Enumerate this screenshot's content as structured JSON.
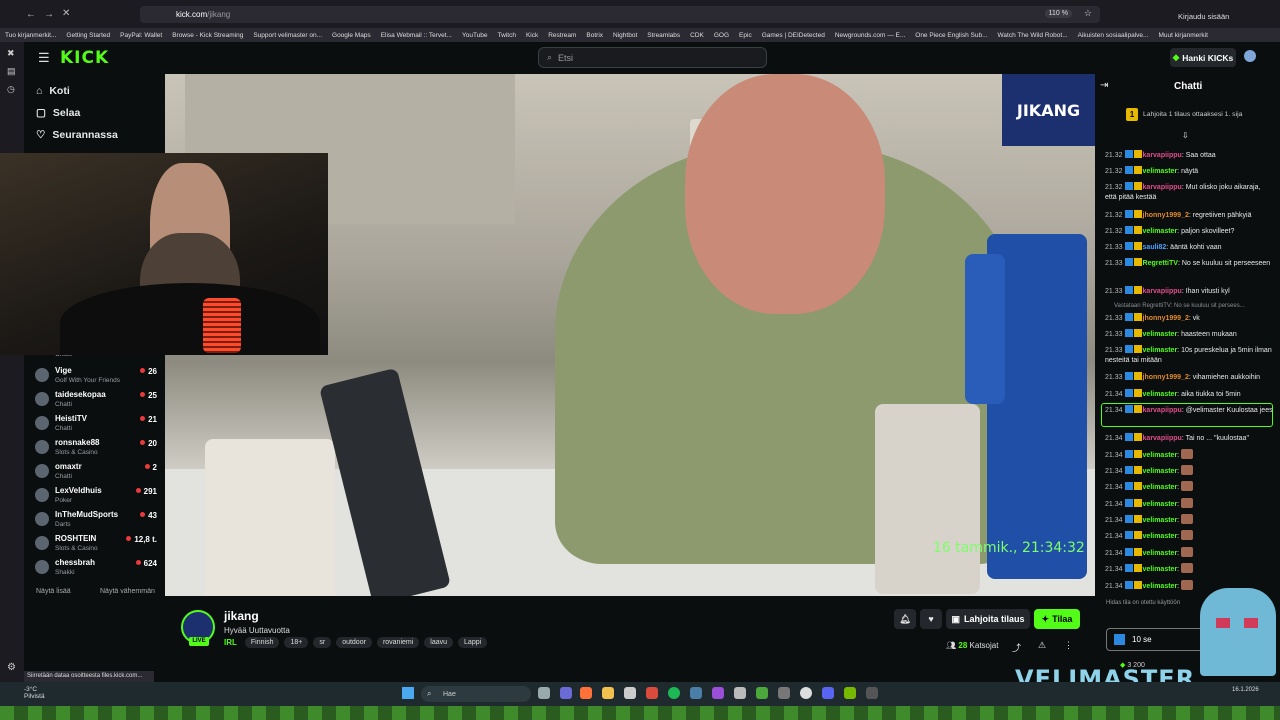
{
  "browser": {
    "url_host": "kick.com",
    "url_path": "/jikang",
    "zoom": "110 %",
    "login": "Kirjaudu sisään",
    "bookmarks": [
      "Tuo kirjanmerkit...",
      "Getting Started",
      "PayPal: Wallet",
      "Browse - Kick Streaming",
      "Support velimaster on...",
      "Google Maps",
      "Elisa Webmail :: Tervet...",
      "YouTube",
      "Twitch",
      "Kick",
      "Restream",
      "Botrix",
      "Nightbot",
      "Streamlabs",
      "CDK",
      "GOG",
      "Epic",
      "Games | DEIDetected",
      "Newgrounds.com — E...",
      "One Piece English Sub...",
      "Watch The Wild Robot...",
      "Aikuisten sosiaalipalve...",
      "Muut kirjanmerkit"
    ]
  },
  "kick": {
    "logo": "KICK",
    "search_placeholder": "Etsi",
    "hanki_label": "Hanki KICKs",
    "nav": {
      "home": "Koti",
      "browse": "Selaa",
      "following": "Seurannassa"
    },
    "channels": [
      {
        "name": "",
        "category": "Chatti",
        "viewers": ""
      },
      {
        "name": "Vige",
        "category": "Golf With Your Friends",
        "viewers": "26"
      },
      {
        "name": "taidesekopaa",
        "category": "Chatti",
        "viewers": "25"
      },
      {
        "name": "HeistiTV",
        "category": "Chatti",
        "viewers": "21"
      },
      {
        "name": "ronsnake88",
        "category": "Slots & Casino",
        "viewers": "20"
      },
      {
        "name": "omaxtr",
        "category": "Chatti",
        "viewers": "2"
      },
      {
        "name": "LexVeldhuis",
        "category": "Poker",
        "viewers": "291"
      },
      {
        "name": "InTheMudSports",
        "category": "Darts",
        "viewers": "43"
      },
      {
        "name": "ROSHTEIN",
        "category": "Slots & Casino",
        "viewers": "12,8 t."
      },
      {
        "name": "chessbrah",
        "category": "Shakki",
        "viewers": "624"
      }
    ],
    "show_more": "Näytä lisää",
    "show_less": "Näytä vähemmän"
  },
  "stream": {
    "channel": "jikang",
    "title": "Hyvää Uuttavuotta",
    "category": "IRL",
    "tags": [
      "Finnish",
      "18+",
      "sr",
      "outdoor",
      "rovaniemi",
      "laavu",
      "Lappi"
    ],
    "live_label": "LIVE",
    "gift_label": "Lahjoita tilaus",
    "sub_label": "Tilaa",
    "viewers": "28",
    "viewers_label": "Katsojat",
    "timestamp_overlay": "16 tammik., 21:34:32",
    "badge": "JIKANG"
  },
  "chat": {
    "title": "Chatti",
    "sub_prompt_rank": "1",
    "sub_prompt": "Lahjoita 1 tilaus ottaaksesi 1. sija",
    "messages": [
      {
        "time": "21.32",
        "user": "karvapiippu",
        "color": "#e04c8a",
        "text": "Saa ottaa"
      },
      {
        "time": "21.32",
        "user": "velimaster",
        "color": "#53fc18",
        "text": "näytä"
      },
      {
        "time": "21.32",
        "user": "karvapiippu",
        "color": "#e04c8a",
        "text": "Mut olisko joku aikaraja, että pitää kestää"
      },
      {
        "time": "21.32",
        "user": "jhonny1999_2",
        "color": "#e08a2c",
        "text": "regretiiven pähkyiä"
      },
      {
        "time": "21.32",
        "user": "velimaster",
        "color": "#53fc18",
        "text": "paljon skovilleet?"
      },
      {
        "time": "21.33",
        "user": "sauli82",
        "color": "#4aa3ff",
        "text": "ääntä kohti vaan"
      },
      {
        "time": "21.33",
        "user": "RegrettiTV",
        "color": "#53fc18",
        "text": "No se kuuluu sit perseeseen"
      },
      {
        "time": "21.33",
        "user": "karvapiippu",
        "color": "#e04c8a",
        "text": "Ihan vitusti kyl"
      },
      {
        "time": "21.33",
        "user": "jhonny1999_2",
        "color": "#e08a2c",
        "text": "vk"
      },
      {
        "time": "21.33",
        "user": "velimaster",
        "color": "#53fc18",
        "text": "haasteen mukaan"
      },
      {
        "time": "21.33",
        "user": "velimaster",
        "color": "#53fc18",
        "text": "10s pureskelua ja 5min ilman nesteitä tai mitään"
      },
      {
        "time": "21.33",
        "user": "jhonny1999_2",
        "color": "#e08a2c",
        "text": "vihamiehen aukkoihin"
      },
      {
        "time": "21.34",
        "user": "velimaster",
        "color": "#53fc18",
        "text": "aika tiukka toi 5min"
      },
      {
        "time": "21.34",
        "user": "karvapiippu",
        "color": "#e04c8a",
        "text": "@velimaster Kuulostaa jees"
      },
      {
        "time": "21.34",
        "user": "karvapiippu",
        "color": "#e04c8a",
        "text": "Tai no ... \"kuulostaa\""
      },
      {
        "time": "21.34",
        "user": "velimaster",
        "color": "#53fc18",
        "text": ""
      },
      {
        "time": "21.34",
        "user": "velimaster",
        "color": "#53fc18",
        "text": ""
      },
      {
        "time": "21.34",
        "user": "velimaster",
        "color": "#53fc18",
        "text": ""
      },
      {
        "time": "21.34",
        "user": "velimaster",
        "color": "#53fc18",
        "text": ""
      },
      {
        "time": "21.34",
        "user": "velimaster",
        "color": "#53fc18",
        "text": ""
      },
      {
        "time": "21.34",
        "user": "velimaster",
        "color": "#53fc18",
        "text": ""
      },
      {
        "time": "21.34",
        "user": "velimaster",
        "color": "#53fc18",
        "text": ""
      },
      {
        "time": "21.34",
        "user": "velimaster",
        "color": "#53fc18",
        "text": ""
      },
      {
        "time": "21.34",
        "user": "velimaster",
        "color": "#53fc18",
        "text": ""
      }
    ],
    "reply_note": "Vastataan RegrettiTV: No se kuuluu sit persees...",
    "slow_mode": "Hidas tila on otettu käyttöön",
    "input_value": "10 se",
    "kicks_balance": "3 200",
    "overlay_name": "VELIMASTER"
  },
  "os": {
    "status": "Siirretään dataa osoitteesta files.kick.com...",
    "weather_temp": "-3°C",
    "weather_label": "Pilvistä",
    "search": "Hae",
    "date": "16.1.2026"
  }
}
